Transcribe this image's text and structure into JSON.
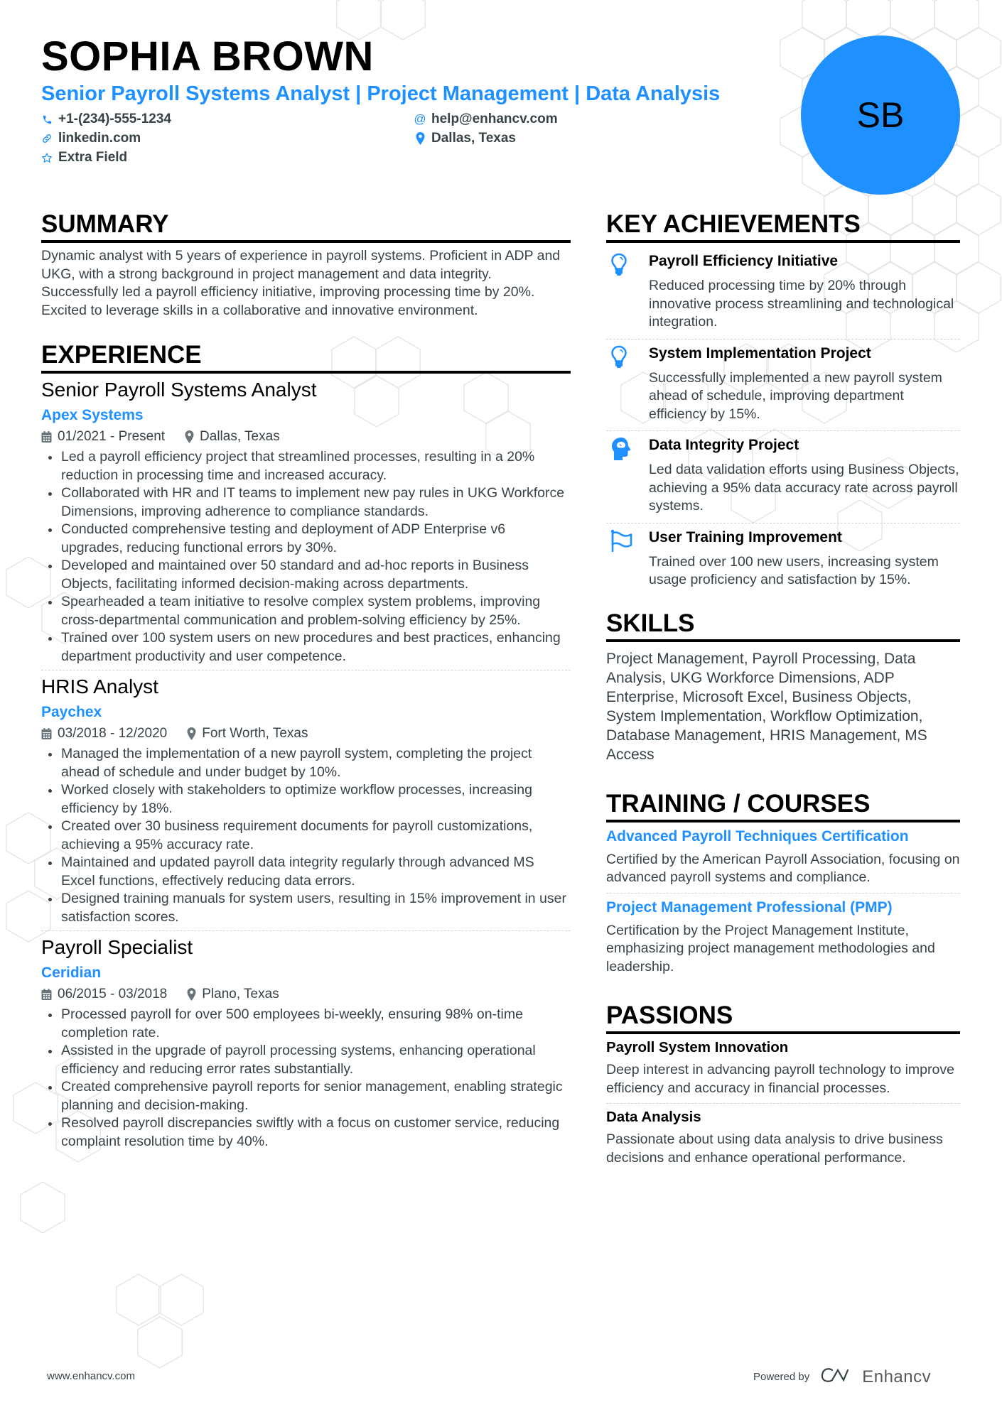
{
  "header": {
    "name": "SOPHIA BROWN",
    "headline": "Senior Payroll Systems Analyst | Project Management | Data Analysis",
    "initials": "SB",
    "contacts": [
      {
        "icon": "phone-icon",
        "text": "+1-(234)-555-1234"
      },
      {
        "icon": "at-icon",
        "text": "help@enhancv.com"
      },
      {
        "icon": "link-icon",
        "text": "linkedin.com"
      },
      {
        "icon": "location-pin-icon",
        "text": "Dallas, Texas"
      },
      {
        "icon": "star-icon",
        "text": "Extra Field"
      }
    ]
  },
  "colors": {
    "accent": "#1e90ff",
    "text": "#384347",
    "heading": "#000000"
  },
  "summary": {
    "title": "SUMMARY",
    "text": "Dynamic analyst with 5 years of experience in payroll systems. Proficient in ADP and UKG, with a strong background in project management and data integrity. Successfully led a payroll efficiency initiative, improving processing time by 20%. Excited to leverage skills in a collaborative and innovative environment."
  },
  "experience": {
    "title": "EXPERIENCE",
    "jobs": [
      {
        "title": "Senior Payroll Systems Analyst",
        "company": "Apex Systems",
        "dates": "01/2021 - Present",
        "location": "Dallas, Texas",
        "bullets": [
          "Led a payroll efficiency project that streamlined processes, resulting in a 20% reduction in processing time and increased accuracy.",
          "Collaborated with HR and IT teams to implement new pay rules in UKG Workforce Dimensions, improving adherence to compliance standards.",
          "Conducted comprehensive testing and deployment of ADP Enterprise v6 upgrades, reducing functional errors by 30%.",
          "Developed and maintained over 50 standard and ad-hoc reports in Business Objects, facilitating informed decision-making across departments.",
          "Spearheaded a team initiative to resolve complex system problems, improving cross-departmental communication and problem-solving efficiency by 25%.",
          "Trained over 100 system users on new procedures and best practices, enhancing department productivity and user competence."
        ]
      },
      {
        "title": "HRIS Analyst",
        "company": "Paychex",
        "dates": "03/2018 - 12/2020",
        "location": "Fort Worth, Texas",
        "bullets": [
          "Managed the implementation of a new payroll system, completing the project ahead of schedule and under budget by 10%.",
          "Worked closely with stakeholders to optimize workflow processes, increasing efficiency by 18%.",
          "Created over 30 business requirement documents for payroll customizations, achieving a 95% accuracy rate.",
          "Maintained and updated payroll data integrity regularly through advanced MS Excel functions, effectively reducing data errors.",
          "Designed training manuals for system users, resulting in 15% improvement in user satisfaction scores."
        ]
      },
      {
        "title": "Payroll Specialist",
        "company": "Ceridian",
        "dates": "06/2015 - 03/2018",
        "location": "Plano, Texas",
        "bullets": [
          "Processed payroll for over 500 employees bi-weekly, ensuring 98% on-time completion rate.",
          "Assisted in the upgrade of payroll processing systems, enhancing operational efficiency and reducing error rates substantially.",
          "Created comprehensive payroll reports for senior management, enabling strategic planning and decision-making.",
          "Resolved payroll discrepancies swiftly with a focus on customer service, reducing complaint resolution time by 40%."
        ]
      }
    ]
  },
  "achievements": {
    "title": "KEY ACHIEVEMENTS",
    "items": [
      {
        "icon": "lightbulb-icon",
        "title": "Payroll Efficiency Initiative",
        "desc": "Reduced processing time by 20% through innovative process streamlining and technological integration."
      },
      {
        "icon": "lightbulb-icon",
        "title": "System Implementation Project",
        "desc": "Successfully implemented a new payroll system ahead of schedule, improving department efficiency by 15%."
      },
      {
        "icon": "brain-head-icon",
        "title": "Data Integrity Project",
        "desc": "Led data validation efforts using Business Objects, achieving a 95% data accuracy rate across payroll systems."
      },
      {
        "icon": "flag-icon",
        "title": "User Training Improvement",
        "desc": "Trained over 100 new users, increasing system usage proficiency and satisfaction by 15%."
      }
    ]
  },
  "skills": {
    "title": "SKILLS",
    "text": "Project Management, Payroll Processing, Data Analysis, UKG Workforce Dimensions, ADP Enterprise, Microsoft Excel, Business Objects, System Implementation, Workflow Optimization, Database Management, HRIS Management, MS Access"
  },
  "training": {
    "title": "TRAINING / COURSES",
    "items": [
      {
        "title": "Advanced Payroll Techniques Certification",
        "desc": "Certified by the American Payroll Association, focusing on advanced payroll systems and compliance."
      },
      {
        "title": "Project Management Professional (PMP)",
        "desc": "Certification by the Project Management Institute, emphasizing project management methodologies and leadership."
      }
    ]
  },
  "passions": {
    "title": "PASSIONS",
    "items": [
      {
        "title": "Payroll System Innovation",
        "desc": "Deep interest in advancing payroll technology to improve efficiency and accuracy in financial processes."
      },
      {
        "title": "Data Analysis",
        "desc": "Passionate about using data analysis to drive business decisions and enhance operational performance."
      }
    ]
  },
  "footer": {
    "website": "www.enhancv.com",
    "powered_by": "Powered by",
    "brand": "Enhancv"
  }
}
